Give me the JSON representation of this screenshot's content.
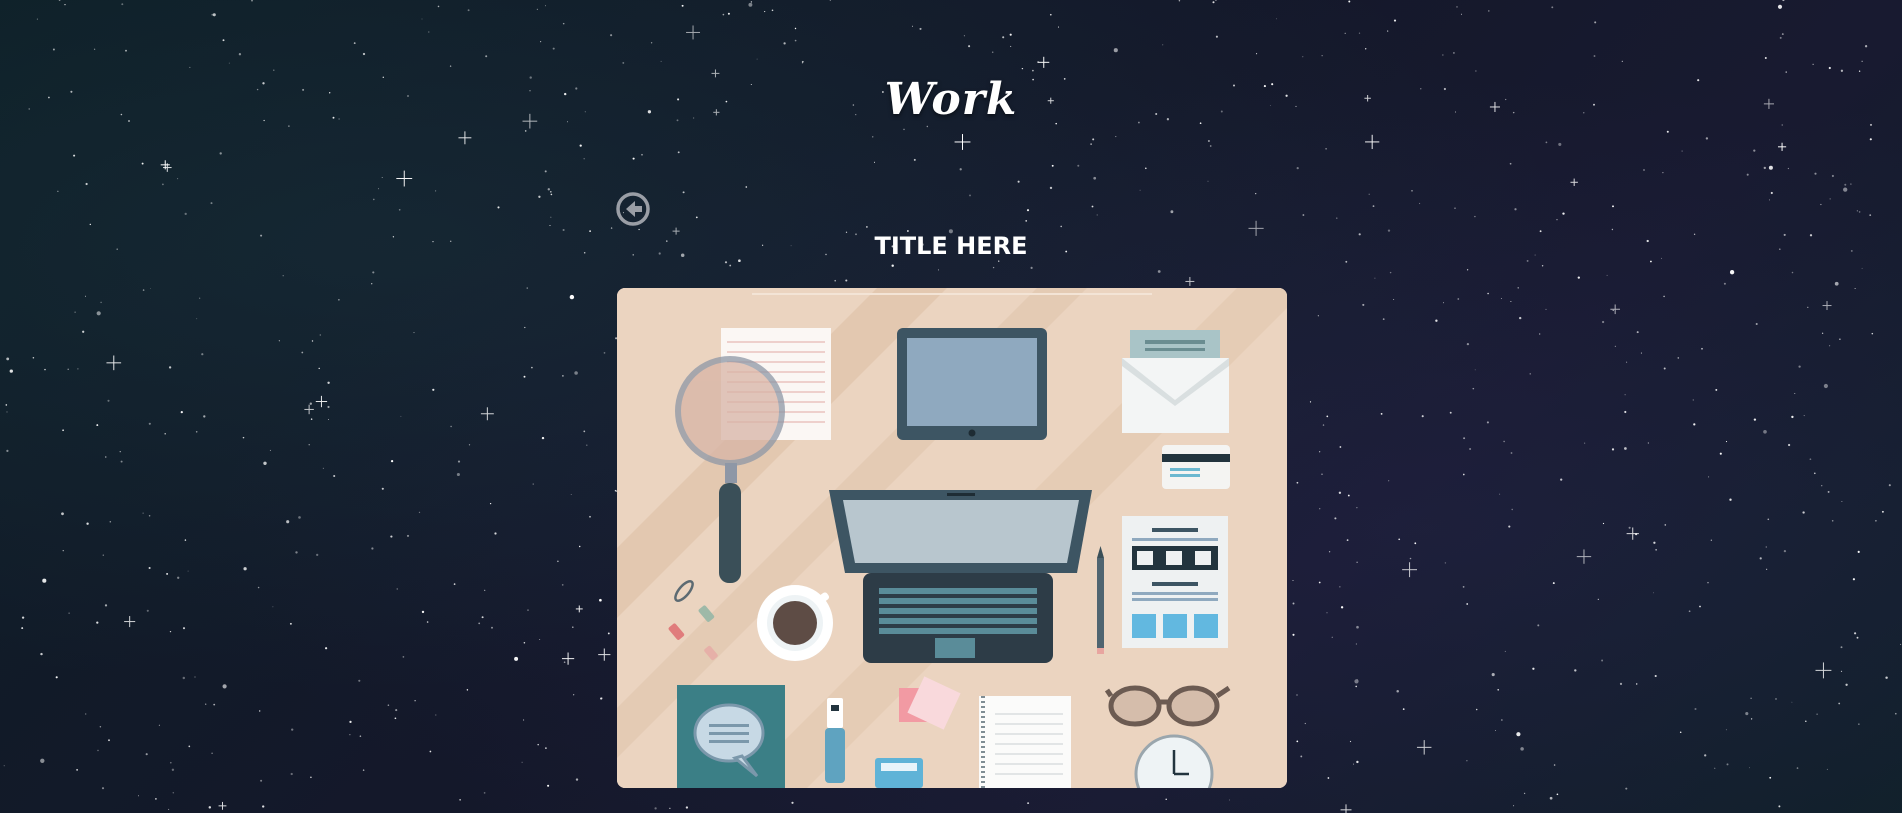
{
  "header": {
    "title": "Work"
  },
  "navigation": {
    "back_icon": "arrow-left-circle-icon"
  },
  "card": {
    "title": "TITLE HERE",
    "image_subject": "desk-flat-illustration"
  },
  "colors": {
    "background": "#121a28",
    "text": "#ffffff",
    "illustration_bg": "#ebd4c0",
    "back_icon": "#9a9ea6"
  }
}
